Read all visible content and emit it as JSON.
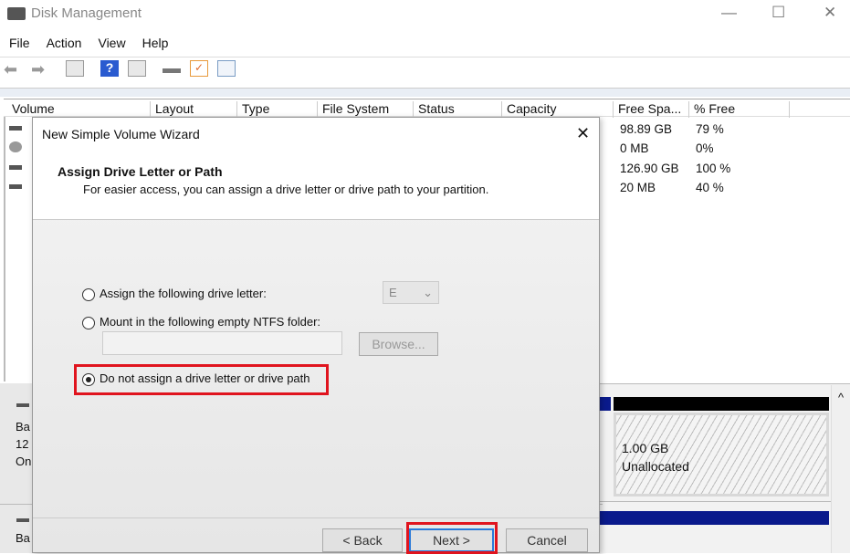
{
  "window": {
    "title": "Disk Management",
    "minimize": "—",
    "maximize": "☐",
    "close": "✕"
  },
  "menu": [
    "File",
    "Action",
    "View",
    "Help"
  ],
  "toolbar_icons": [
    "back-icon",
    "forward-icon",
    "console-tree-icon",
    "help-icon",
    "action-pane-icon",
    "connect-icon",
    "properties-icon",
    "settings-icon"
  ],
  "table": {
    "columns": [
      "Volume",
      "Layout",
      "Type",
      "File System",
      "Status",
      "Capacity",
      "Free Spa...",
      "% Free"
    ],
    "rows": [
      {
        "free": "98.89 GB",
        "pct": "79 %"
      },
      {
        "free": "0 MB",
        "pct": "0%"
      },
      {
        "free": "126.90 GB",
        "pct": "100 %"
      },
      {
        "free": "20 MB",
        "pct": "40 %"
      }
    ]
  },
  "disks": [
    {
      "lines": [
        "Ba",
        "12",
        "On"
      ]
    },
    {
      "lines": [
        "Ba"
      ]
    }
  ],
  "unallocated": {
    "size": "1.00 GB",
    "label": "Unallocated"
  },
  "scroll_up": "^",
  "dialog": {
    "title": "New Simple Volume Wizard",
    "close": "✕",
    "heading": "Assign Drive Letter or Path",
    "subheading": "For easier access, you can assign a drive letter or drive path to your partition.",
    "options": [
      {
        "label": "Assign the following drive letter:",
        "selected": false
      },
      {
        "label": "Mount in the following empty NTFS folder:",
        "selected": false
      },
      {
        "label": "Do not assign a drive letter or drive path",
        "selected": true
      }
    ],
    "drive_letter": "E",
    "folder_path": "",
    "browse": "Browse...",
    "back": "< Back",
    "next": "Next >",
    "cancel": "Cancel"
  },
  "colors": {
    "highlight": "#e0141e",
    "partition_blue": "#0a1a8c"
  }
}
